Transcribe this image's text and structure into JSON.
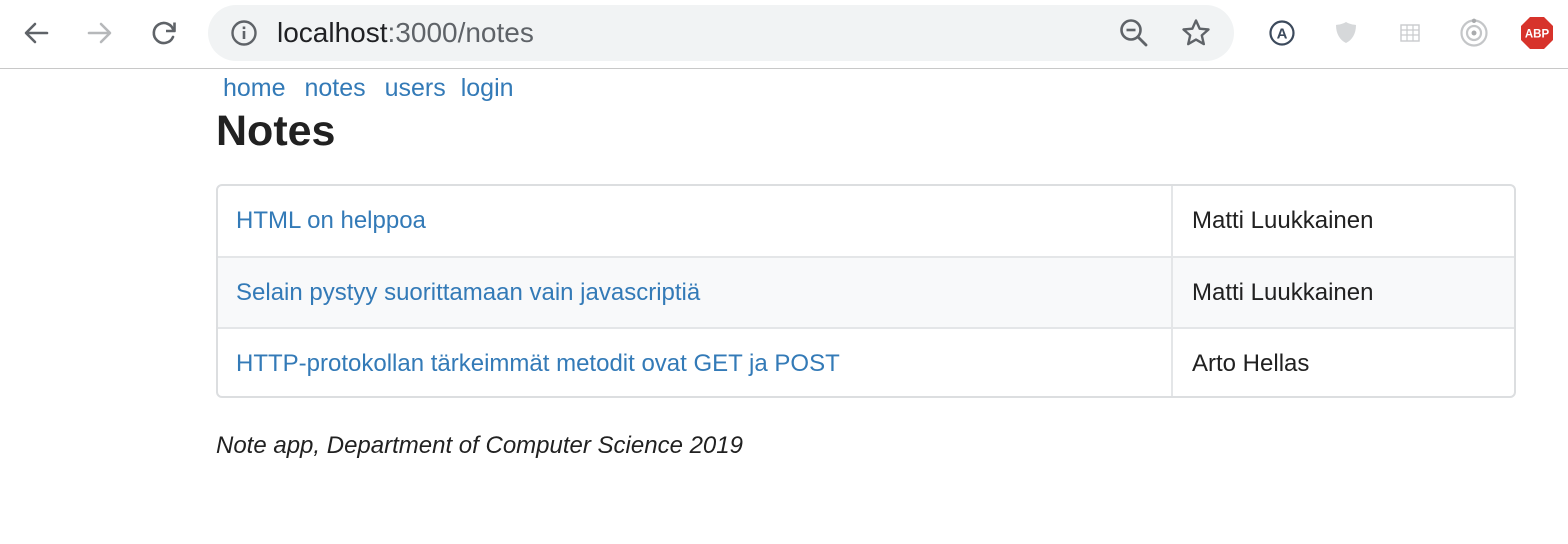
{
  "browser": {
    "url_host": "localhost",
    "url_rest": ":3000/notes",
    "icons": {
      "back": "back-arrow-icon",
      "forward": "forward-arrow-icon",
      "reload": "reload-icon",
      "info": "info-icon",
      "zoom": "zoom-out-icon",
      "bookmark": "star-icon"
    },
    "extensions": [
      "A",
      "",
      "",
      "",
      "ABP"
    ]
  },
  "nav": {
    "home": "home",
    "notes": "notes",
    "users": "users",
    "login": "login"
  },
  "page": {
    "title": "Notes",
    "footer": "Note app, Department of Computer Science 2019"
  },
  "notes": [
    {
      "title": "HTML on helppoa",
      "author": "Matti Luukkainen"
    },
    {
      "title": "Selain pystyy suorittamaan vain javascriptiä",
      "author": "Matti Luukkainen"
    },
    {
      "title": "HTTP-protokollan tärkeimmät metodit ovat GET ja POST",
      "author": "Arto Hellas"
    }
  ],
  "colors": {
    "link": "#337ab7",
    "text": "#212121",
    "abp": "#d7332b"
  }
}
